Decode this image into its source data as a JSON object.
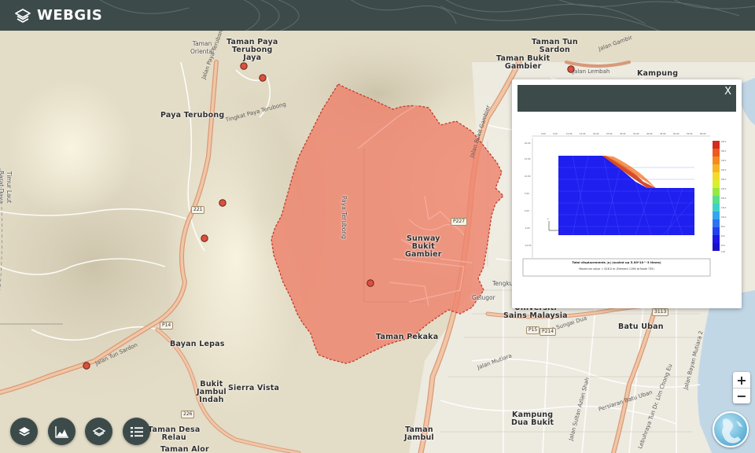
{
  "app": {
    "name": "WEBGIS"
  },
  "colors": {
    "header": "#3c4b4a",
    "polygon_fill": "#ee826c",
    "polygon_stroke": "#c23b2c",
    "marker": "#d9503f"
  },
  "map": {
    "place_labels": [
      {
        "id": "taman-oriental",
        "text": "Taman\nOriental",
        "style": "small"
      },
      {
        "id": "taman-paya-terubong-jaya",
        "text": "Taman Paya\nTerubong\nJaya",
        "style": "big"
      },
      {
        "id": "paya-terubong",
        "text": "Paya Terubong",
        "style": "big"
      },
      {
        "id": "taman-tun-sardon",
        "text": "Taman Tun\nSardon",
        "style": "big"
      },
      {
        "id": "taman-bukit-gambier",
        "text": "Taman Bukit\nGambier",
        "style": "big"
      },
      {
        "id": "kampung",
        "text": "Kampung",
        "style": "big"
      },
      {
        "id": "sunway-bukit-gambier",
        "text": "Sunway\nBukit\nGambier",
        "style": "big"
      },
      {
        "id": "universiti-sains-malaysia",
        "text": "Universiti\nSains Malaysia",
        "style": "big"
      },
      {
        "id": "batu-uban",
        "text": "Batu Uban",
        "style": "big"
      },
      {
        "id": "taman-pekaka",
        "text": "Taman Pekaka",
        "style": "big"
      },
      {
        "id": "bayan-lepas",
        "text": "Bayan Lepas",
        "style": "big"
      },
      {
        "id": "bukit-jambul-indah",
        "text": "Bukit\nJambul\nIndah",
        "style": "big"
      },
      {
        "id": "sierra-vista",
        "text": "Sierra Vista",
        "style": "big"
      },
      {
        "id": "taman-desa-relau",
        "text": "Taman Desa\nRelau",
        "style": "big"
      },
      {
        "id": "taman-alor",
        "text": "Taman Alor",
        "style": "big"
      },
      {
        "id": "kampung-dua-bukit",
        "text": "Kampung\nDua Bukit",
        "style": "big"
      },
      {
        "id": "taman-jambul",
        "text": "Taman\nJambul",
        "style": "big"
      },
      {
        "id": "timur-laut-barat-daya",
        "text": "Timur Laut\nBarat Daya",
        "style": "small"
      },
      {
        "id": "paya-terubong-boundary",
        "text": "Paya Terubong",
        "style": "small"
      },
      {
        "id": "gelugor",
        "text": "Gelugor",
        "style": "small"
      },
      {
        "id": "tengku",
        "text": "Tengku",
        "style": "small"
      }
    ],
    "road_labels": [
      {
        "id": "jalan-paya-terubong",
        "text": "Jalan Paya Terubong"
      },
      {
        "id": "jalan-tun-sardon",
        "text": "Jalan Tun Sardon"
      },
      {
        "id": "jalan-bukit-gambier",
        "text": "Jalan Bukit Gambier"
      },
      {
        "id": "jalan-lembah",
        "text": "Jalan Lembah"
      },
      {
        "id": "jalan-sultan-azlan-shah",
        "text": "Jalan Sultan Azlan Shah"
      },
      {
        "id": "jalan-sungai-dua",
        "text": "Jalan Sungai Dua"
      },
      {
        "id": "persiaran-batu-uban",
        "text": "Persiaran Batu Uban"
      },
      {
        "id": "jalan-bayan-mutiara",
        "text": "Jalan Bayan Mutiara 2"
      },
      {
        "id": "lebuhraya-tun-dr-lim",
        "text": "Lebuhraya Tun Dr. Lim Chong Eu"
      },
      {
        "id": "tingkat-paya-terubong",
        "text": "Tingkat Paya Terubong"
      },
      {
        "id": "jalan-gambir",
        "text": "Jalan Gambir"
      },
      {
        "id": "jalan-mutiara",
        "text": "Jalan Mutiara"
      }
    ],
    "route_shields": [
      {
        "id": "r-221",
        "text": "221"
      },
      {
        "id": "r-p14",
        "text": "P14"
      },
      {
        "id": "r-p15",
        "text": "P15"
      },
      {
        "id": "r-p214",
        "text": "P214"
      },
      {
        "id": "r-p227",
        "text": "P227"
      },
      {
        "id": "r-3113",
        "text": "3113"
      },
      {
        "id": "r-226",
        "text": "226"
      }
    ],
    "markers_count": 7
  },
  "popup": {
    "close_label": "X",
    "chart": {
      "caption_title": "Total displacements |u| (scaled up 5.00*10^-3 times)",
      "caption_sub": "Maximum value = 428.0 m (Element 1196 at Node 735)"
    }
  },
  "zoom": {
    "in_label": "+",
    "out_label": "−"
  },
  "tools": [
    {
      "id": "layers",
      "icon": "layers-icon"
    },
    {
      "id": "elevation",
      "icon": "elevation-chart-icon"
    },
    {
      "id": "basemap",
      "icon": "stack-icon"
    },
    {
      "id": "legend",
      "icon": "list-icon"
    }
  ]
}
